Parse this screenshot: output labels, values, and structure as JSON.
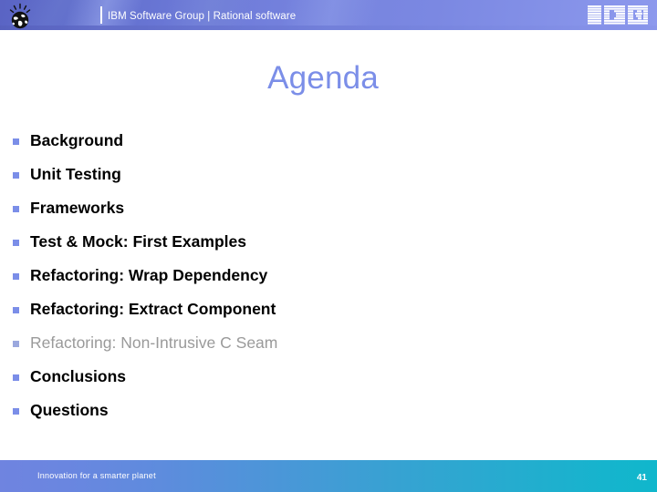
{
  "header": {
    "brand_text": "IBM Software Group | Rational software",
    "logo_text": "IBM",
    "accent_color": "#7b8ee8",
    "band_color": "#6d7ad8"
  },
  "title": {
    "text": "Agenda",
    "color": "#7b8ee8"
  },
  "agenda": {
    "bullet_color": "#7b8ee8",
    "items": [
      {
        "label": "Background",
        "state": "normal"
      },
      {
        "label": "Unit Testing",
        "state": "normal"
      },
      {
        "label": "Frameworks",
        "state": "normal"
      },
      {
        "label": "Test & Mock: First Examples",
        "state": "normal"
      },
      {
        "label": "Refactoring: Wrap Dependency",
        "state": "normal"
      },
      {
        "label": "Refactoring: Extract Component",
        "state": "normal"
      },
      {
        "label": "Refactoring: Non-Intrusive C Seam",
        "state": "dimmed"
      },
      {
        "label": "Conclusions",
        "state": "normal"
      },
      {
        "label": "Questions",
        "state": "normal"
      }
    ]
  },
  "footer": {
    "tagline": "Innovation for a smarter planet",
    "page_number": "41",
    "icon_name": "smarter-planet-globe-icon",
    "gradient_start": "#6f84e0",
    "gradient_end": "#10b7cc"
  }
}
